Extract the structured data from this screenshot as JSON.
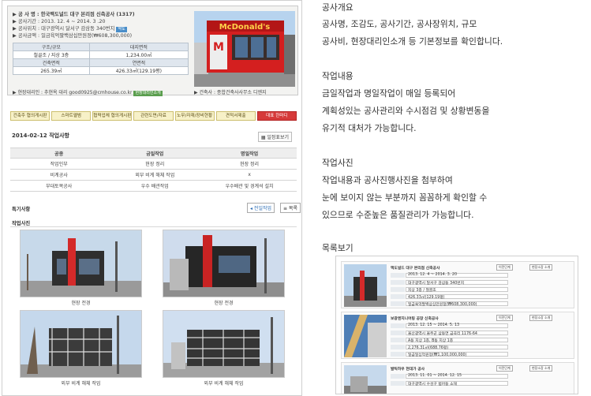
{
  "project": {
    "line1": "▶ 공 사 명 : 한국맥도널드 대구 본리점 신축공사 (1317)",
    "line2": "▶ 공사기간 : 2013. 12. 4 ~ 2014. 3 .20",
    "line3": "▶ 공사위치 : 대구광역시 달서구 감삼동 340번지",
    "map_tag": "약도",
    "line4": "▶ 공사금액 : 일금육억팔백삼십만원정(₩608,300,000)",
    "manager": "▶ 현장대리인 : 추현옥 대리 good0925@cmhouse.co.kr",
    "manager_tag": "현장대리인소개",
    "architect": "▶ 건축사 : 종합건축사사무소 디엔지"
  },
  "spec_table": {
    "h1": "구조/규모",
    "h2": "대지면적",
    "v1": "철골조 / 지상 3층",
    "v2": "1,234.00㎡",
    "h3": "건축면적",
    "h4": "연면적",
    "v3": "265.39㎡",
    "v4": "426.33㎡(129.19평)"
  },
  "tabs": [
    "건축주 협의게시판",
    "스마트앨범",
    "협력업체 협의게시판",
    "관련도면/자료",
    "노무/자재/장비현황",
    "견적서제출",
    "대표 한마디"
  ],
  "work": {
    "date": "2014-02-12 작업사항",
    "print_label": "일정표보기",
    "headers": [
      "공종",
      "금일작업",
      "명일작업"
    ],
    "rows": [
      [
        "작업인부",
        "현장 정리",
        "현장 정리"
      ],
      [
        "비계공사",
        "외부 비계 해체 작업",
        "x"
      ],
      [
        "부대토목공사",
        "우수 배관작업",
        "우수배관 및 경계석 설치"
      ]
    ],
    "notes_label": "특기사항",
    "prev_label": "◂ 전일작업",
    "list_label": "≡ 목록",
    "photos_label": "작업사진",
    "photos": [
      "현장 전경",
      "현장 전경",
      "외부 비계 해체 작업",
      "외부 비계 해체 작업"
    ]
  },
  "right": {
    "s1_title": "공사개요",
    "s1_l1": "공사명, 조감도, 공사기간, 공사장위치, 규모",
    "s1_l2": "공사비, 현장대리인소개 등 기본정보를 확인합니다.",
    "s2_title": "작업내용",
    "s2_l1": "금일작업과 명일작업이 매일 등록되어",
    "s2_l2": "계획성있는 공사관리와 수시점검 및 상황변동을",
    "s2_l3": "유기적 대처가 가능합니다.",
    "s3_title": "작업사진",
    "s3_l1": "작업내용과 공사진행사진을 첨부하여",
    "s3_l2": "눈에 보이지 않는 부분까지 꼼꼼하게 확인할 수",
    "s3_l3": "있으므로 수준높은 품질관리가 가능합니다.",
    "s4_title": "목록보기"
  },
  "preview": {
    "p1_title": "맥도널드 대구 본리점 신축공사",
    "p1_r1": "2013. 12. 4 ~ 2014. 3. 20",
    "p1_r2": "대구광역시 달서구 감삼동 340번지",
    "p1_r3": "지상 3층 / 철골조",
    "p1_r4": "426.33㎡(129.19평)",
    "p1_r5": "일금육억팔백삼십만원정(₩608,300,000)",
    "p2_title": "보광엔지니어링 공장 신축공사",
    "p2_r1": "2013. 12. 15 ~ 2014. 5. 13",
    "p2_r2": "울산광역시 울주군 삼동면 금곡리 1176-64",
    "p2_r3": "A동 지상 1층, B동 지상 1층",
    "p2_r4": "2,276.31㎡(688.76평)",
    "p2_r5": "일금일십억원정(₩1,100,000,000)",
    "p3_title": "발틱하우 현대가 공사",
    "p3_r1": "2013. 11. 01 ~ 2014. 12. 15",
    "p3_r2": "대구광역시 수성구 범어동 소재",
    "btn_a": "이전단계",
    "btn_b": "현장소장 소개"
  }
}
